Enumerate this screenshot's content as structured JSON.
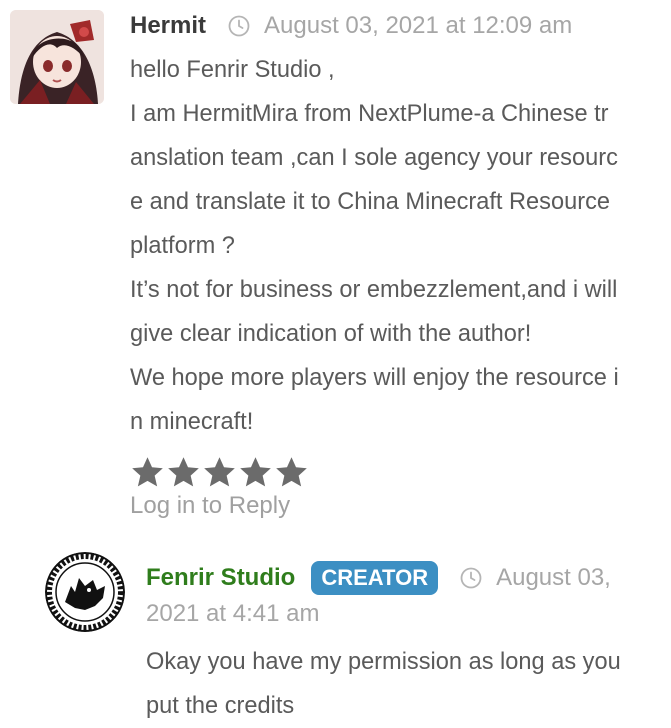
{
  "comment": {
    "author": "Hermit",
    "date": "August 03, 2021 at 12:09 am",
    "body_lines": [
      "hello Fenrir Studio ,",
      "I am HermitMira from NextPlume-a Chinese tr",
      "anslation team ,can I sole agency your resourc",
      "e and translate it to China Minecraft Resource",
      "platform ?",
      "It’s not for business or embezzlement,and i will",
      "give clear indication of with the author!",
      "We hope more players will enjoy the resource i",
      "n minecraft!"
    ],
    "rating": 5,
    "rating_max": 5,
    "reply_link": "Log in to Reply"
  },
  "reply": {
    "author": "Fenrir Studio",
    "badge": "CREATOR",
    "date_line1": "August 03,",
    "date_line2": "2021 at 4:41 am",
    "body_lines": [
      "Okay you have my permission as long as you",
      "put the credits"
    ]
  },
  "colors": {
    "author_text": "#3a3a3a",
    "creator_name": "#2f7d1c",
    "badge_bg": "#3c8fc3",
    "muted": "#a6a6a6",
    "star": "#6b6b6b"
  },
  "icons": {
    "avatar_hermit": "anime-avatar",
    "avatar_fenrir": "wolf-rune-logo",
    "timestamp": "clock-icon",
    "rating": "star-icon"
  }
}
